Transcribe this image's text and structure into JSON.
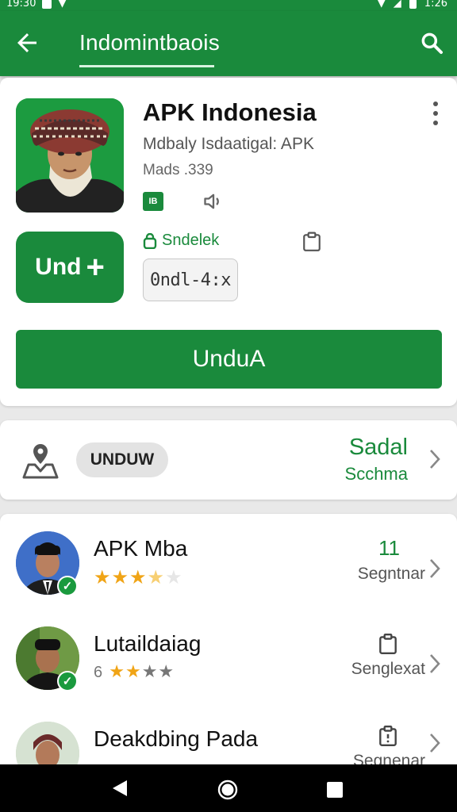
{
  "status_bar": {
    "time": "19:30",
    "clock": "1:26"
  },
  "top_bar": {
    "title": "Indomintbaois",
    "back_icon": "arrow-left-icon",
    "search_icon": "search-icon"
  },
  "app": {
    "name": "APK Indonesia",
    "developer": "Mdbaly Isdaatigal: APK",
    "meta": "Mads .339",
    "badge_label": "IB",
    "install_small_label": "Und",
    "security_label": "Sndelek",
    "version_label": "0ndl-4:x",
    "main_button_label": "UnduA"
  },
  "info_row": {
    "pill_label": "UNDUW",
    "right_title": "Sadal",
    "right_subtitle": "Scchma"
  },
  "list": [
    {
      "name": "APK Mba",
      "rating": 3.5,
      "right_value": "11",
      "right_label": "Segntnar",
      "verified": true
    },
    {
      "name": "Lutaildaiag",
      "prefix": "6",
      "rating": 2,
      "right_label": "Senglexat",
      "verified": true
    },
    {
      "name": "Deakdbing Pada",
      "right_label": "Segnenar",
      "verified": false
    }
  ],
  "colors": {
    "primary": "#1a8a3c",
    "star": "#f0a416"
  }
}
